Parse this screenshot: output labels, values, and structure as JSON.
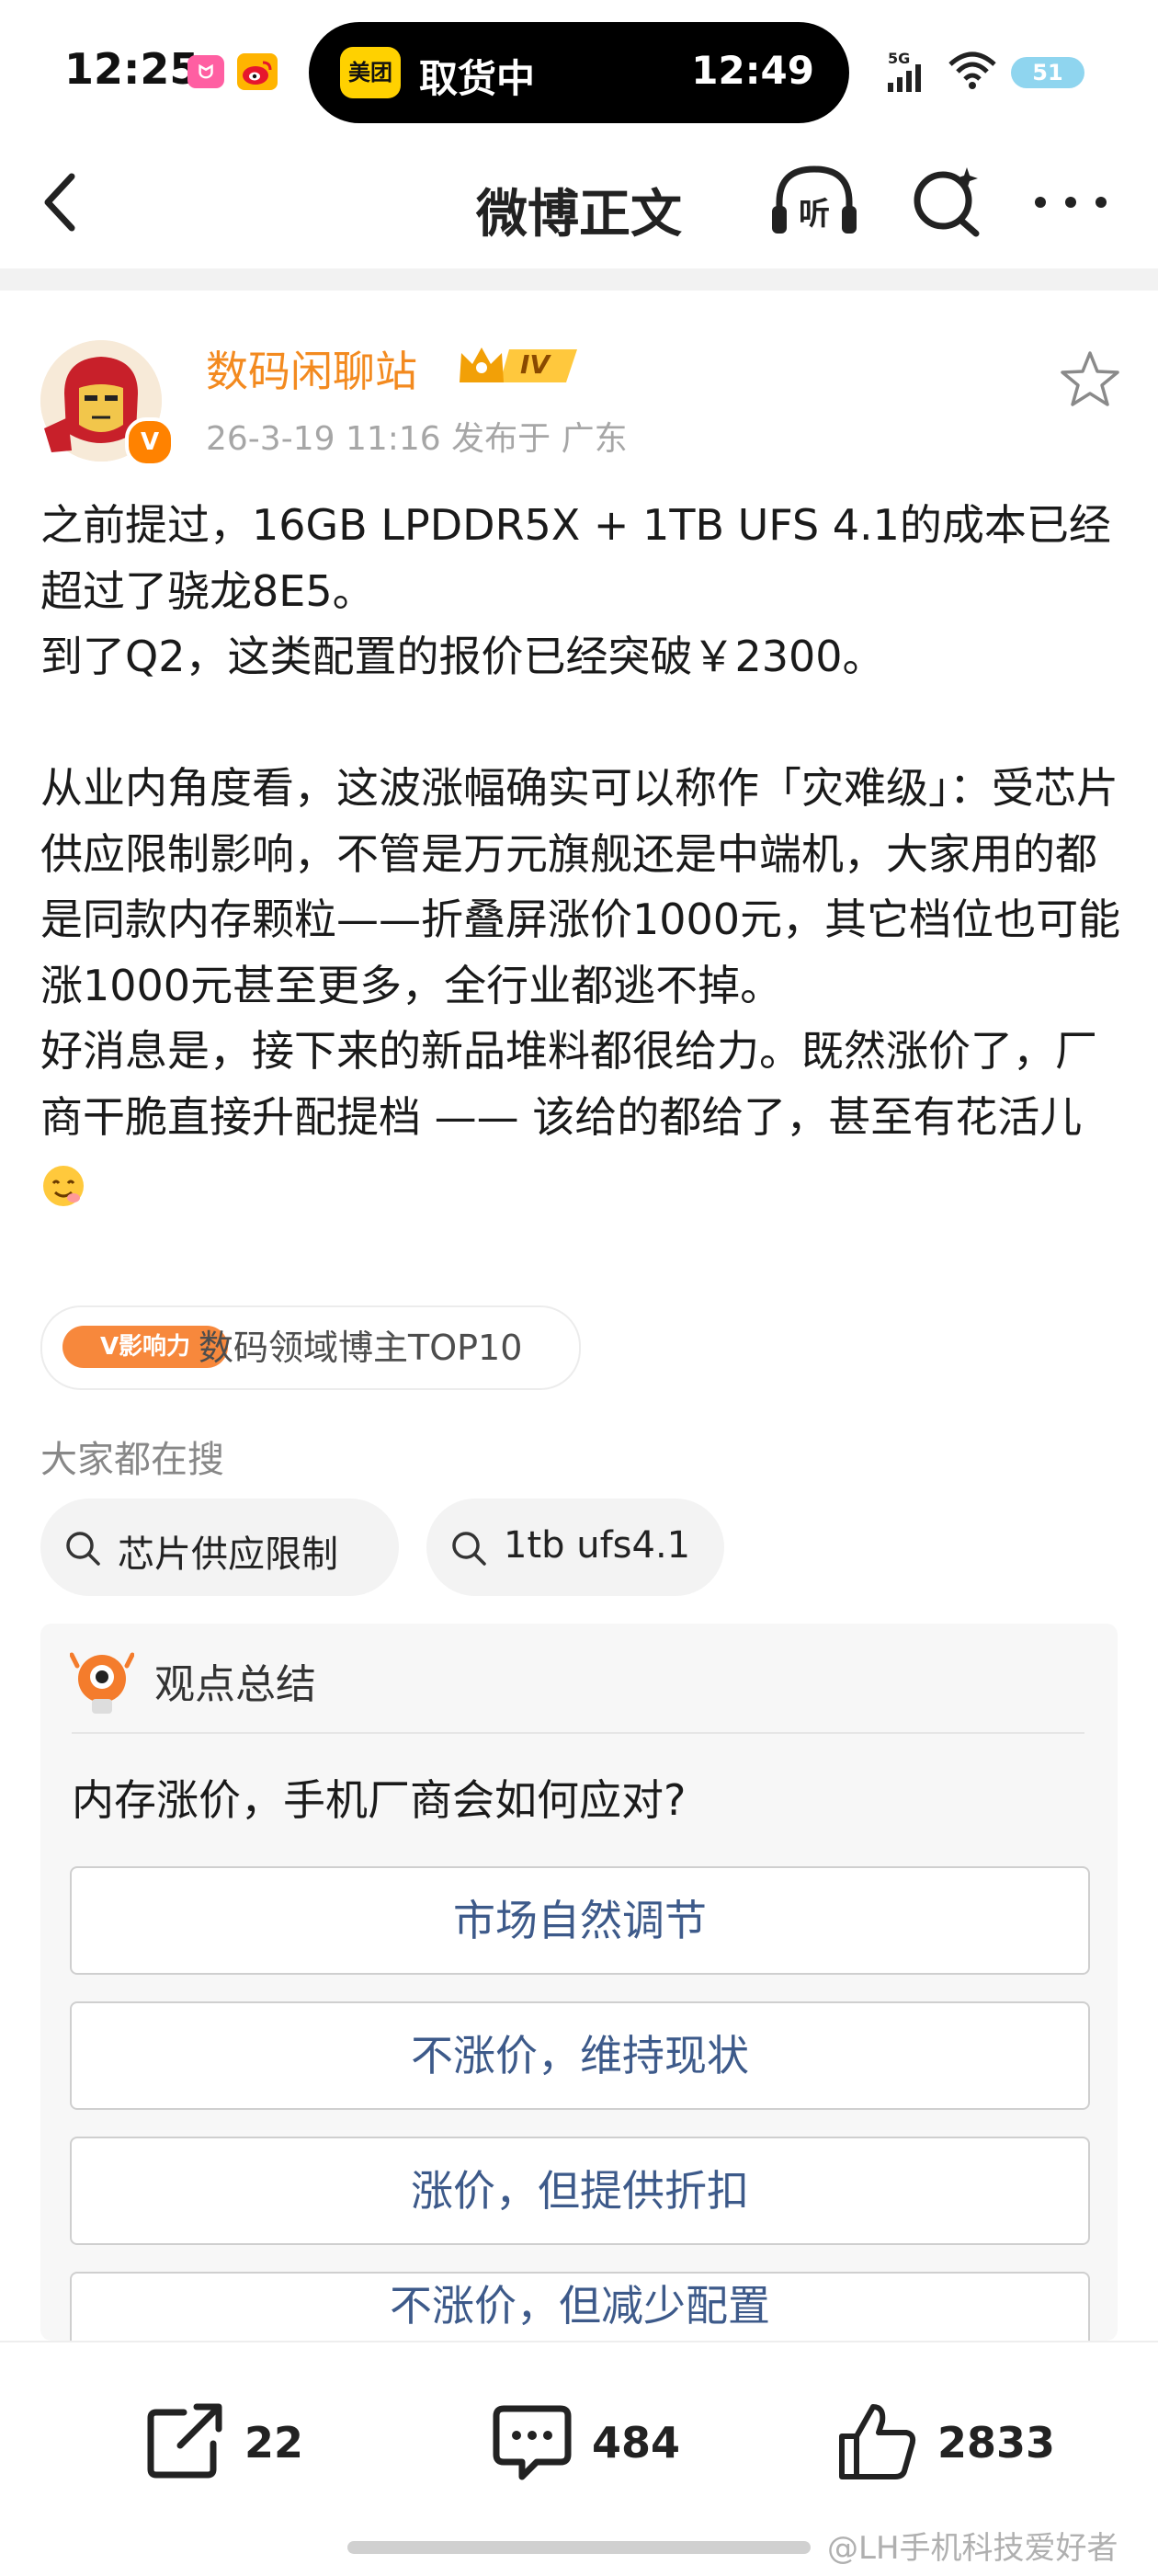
{
  "status_bar": {
    "time": "12:25",
    "app1_label": "ᗢ",
    "island_app": "美团",
    "island_text": "取货中",
    "island_time": "12:49",
    "network": "5G",
    "battery": "51"
  },
  "nav": {
    "title": "微博正文",
    "listen_icon": "listen-icon",
    "search_icon": "search-icon",
    "more_icon": "more-icon"
  },
  "author": {
    "name": "数码闲聊站",
    "verified_mark": "V",
    "level": "IV",
    "time_location": "26-3-19 11:16  发布于 广东"
  },
  "content": {
    "line1": "之前提过，16GB LPDDR5X + 1TB UFS 4.1的成本已经超过了骁龙8E5。",
    "line2": "到了Q2，这类配置的报价已经突破￥2300。",
    "line3": "从业内角度看，这波涨幅确实可以称作「灾难级」：受芯片供应限制影响，不管是万元旗舰还是中端机，大家用的都是同款内存颗粒——折叠屏涨价1000元，其它档位也可能涨1000元甚至更多，全行业都逃不掉。",
    "line4": "好消息是，接下来的新品堆料都很给力。既然涨价了，厂商干脆直接升配提档 —— 该给的都给了，甚至有花活儿"
  },
  "influence": {
    "badge": "V影响力",
    "text": "数码领域博主TOP10"
  },
  "hot_search": {
    "title": "大家都在搜",
    "chips": [
      "芯片供应限制",
      "1tb ufs4.1"
    ]
  },
  "summary": {
    "title": "观点总结",
    "question": "内存涨价，手机厂商会如何应对?",
    "options": [
      "市场自然调节",
      "不涨价，维持现状",
      "涨价，但提供折扣",
      "不涨价，但减少配置"
    ]
  },
  "actions": {
    "share_count": "22",
    "comment_count": "484",
    "like_count": "2833"
  },
  "watermark": "@LH手机科技爱好者",
  "colors": {
    "author_name": "#f38a1f",
    "verify_badge": "#ff8200",
    "option_text": "#3d5a8a",
    "battery": "#8fd5ef"
  }
}
